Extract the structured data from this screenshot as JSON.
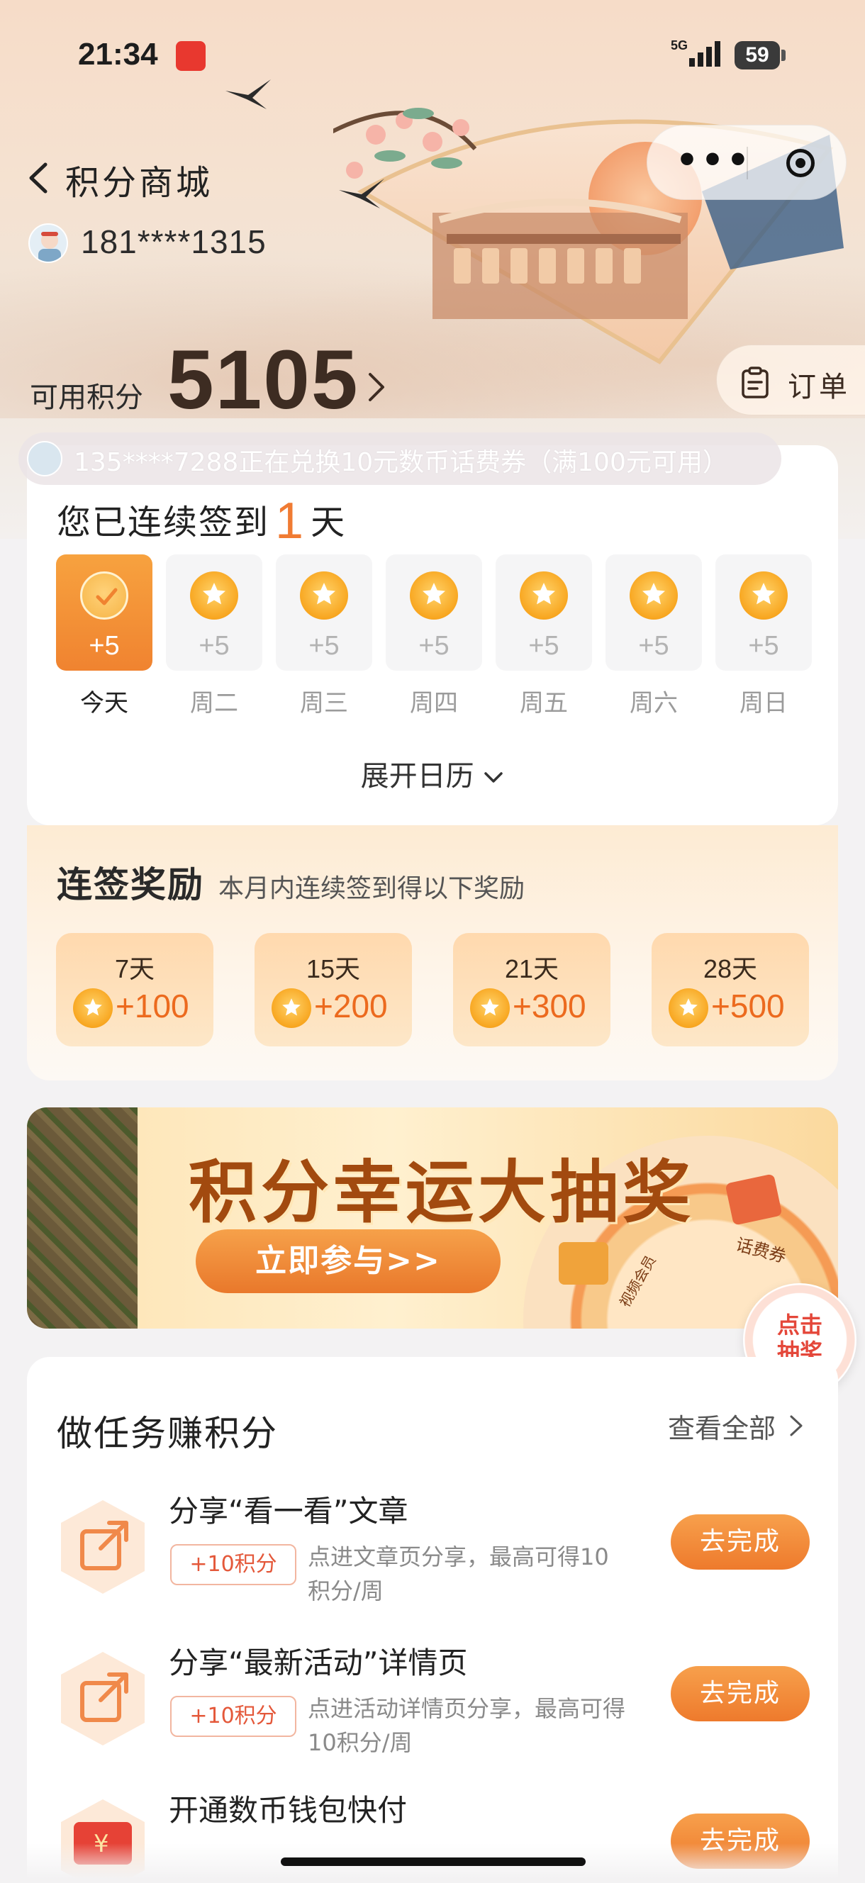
{
  "status_bar": {
    "time": "21:34",
    "network": "5G",
    "battery": "59"
  },
  "nav": {
    "title": "积分商城"
  },
  "user": {
    "phone": "181****1315"
  },
  "points": {
    "label": "可用积分",
    "value": "5105"
  },
  "order_button": {
    "label": "订单"
  },
  "ticker": {
    "text": "135****7288正在兑换10元数币话费券（满100元可用）"
  },
  "signin": {
    "title_prefix": "您已连续签到",
    "streak_days": "1",
    "title_suffix": "天",
    "days": [
      {
        "label": "今天",
        "bonus": "+5",
        "checked": true
      },
      {
        "label": "周二",
        "bonus": "+5",
        "checked": false
      },
      {
        "label": "周三",
        "bonus": "+5",
        "checked": false
      },
      {
        "label": "周四",
        "bonus": "+5",
        "checked": false
      },
      {
        "label": "周五",
        "bonus": "+5",
        "checked": false
      },
      {
        "label": "周六",
        "bonus": "+5",
        "checked": false
      },
      {
        "label": "周日",
        "bonus": "+5",
        "checked": false
      }
    ],
    "expand_label": "展开日历"
  },
  "streak_rewards": {
    "title": "连签奖励",
    "subtitle": "本月内连续签到得以下奖励",
    "items": [
      {
        "days": "7天",
        "amount": "+100"
      },
      {
        "days": "15天",
        "amount": "+200"
      },
      {
        "days": "21天",
        "amount": "+300"
      },
      {
        "days": "28天",
        "amount": "+500"
      }
    ]
  },
  "lottery_banner": {
    "title": "积分幸运大抽奖",
    "join_label": "立即参与>>",
    "prize_label_1": "话费券",
    "prize_label_2": "视频会员"
  },
  "draw_float": {
    "label": "点击抽奖"
  },
  "tasks": {
    "title": "做任务赚积分",
    "view_all": "查看全部",
    "items": [
      {
        "name": "分享“看一看”文章",
        "tag": "+10积分",
        "desc": "点进文章页分享，最高可得10积分/周",
        "button": "去完成"
      },
      {
        "name": "分享“最新活动”详情页",
        "tag": "+10积分",
        "desc": "点进活动详情页分享，最高可得10积分/周",
        "button": "去完成"
      },
      {
        "name": "开通数币钱包快付",
        "tag": "",
        "desc": "",
        "button": "去完成"
      }
    ]
  },
  "colors": {
    "accent": "#f07b33",
    "button": "#ee7a2c",
    "card_bg": "#ffffff",
    "page_bg": "#f3f2f3"
  }
}
